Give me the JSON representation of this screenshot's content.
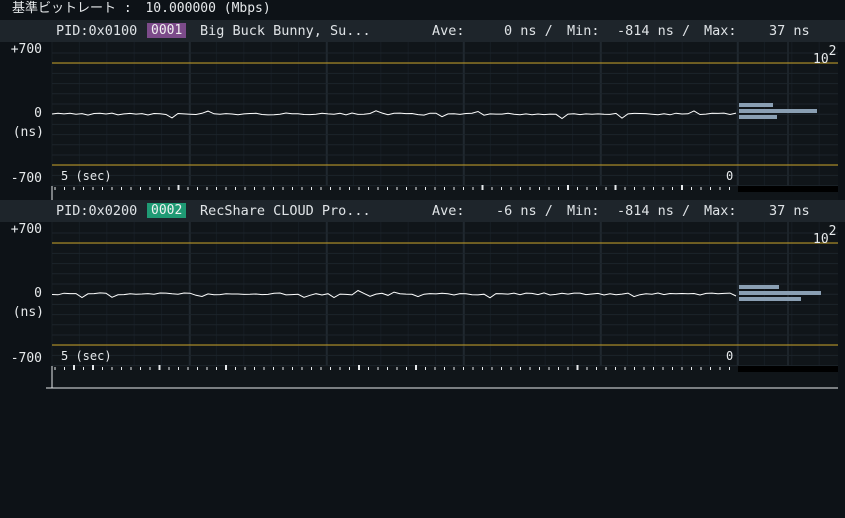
{
  "top": {
    "label": "基準ビットレート :",
    "value": "10.000000 (Mbps)"
  },
  "panels": [
    {
      "pid": "PID:0x0100",
      "id": "0001",
      "badge_color": "#7c4b8a",
      "name": "Big Buck Bunny, Su...",
      "ave_label": "Ave:",
      "ave": "0 ns /",
      "min_label": "Min:",
      "min": "-814 ns /",
      "max_label": "Max:",
      "max": "37 ns",
      "y_top": "+700",
      "y_mid": "0",
      "y_unit": "(ns)",
      "y_bot": "-700",
      "span": "5 (sec)",
      "zero": "0",
      "hist_scale_base": "10",
      "hist_scale_exp": "2"
    },
    {
      "pid": "PID:0x0200",
      "id": "0002",
      "badge_color": "#1f9a74",
      "name": "RecShare CLOUD Pro...",
      "ave_label": "Ave:",
      "ave": "-6 ns /",
      "min_label": "Min:",
      "min": "-814 ns /",
      "max_label": "Max:",
      "max": "37 ns",
      "y_top": "+700",
      "y_mid": "0",
      "y_unit": "(ns)",
      "y_bot": "-700",
      "span": "5 (sec)",
      "zero": "0",
      "hist_scale_base": "10",
      "hist_scale_exp": "2"
    }
  ],
  "colors": {
    "limit_line": "#c9a227",
    "trace": "#ffffff",
    "histogram": "#8a9fb3",
    "grid": "#262e35"
  }
}
